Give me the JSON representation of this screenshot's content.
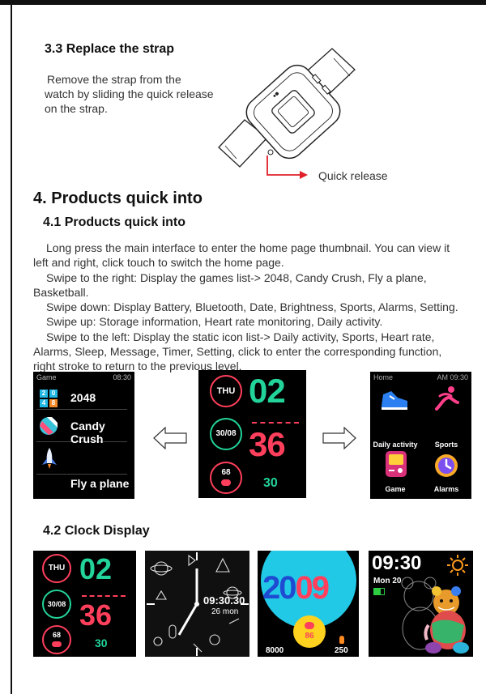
{
  "section_3_3": {
    "heading": "3.3 Replace the strap",
    "body_lines": [
      "Remove the strap from the",
      "watch by sliding the quick release",
      "on the strap."
    ],
    "callout": "Quick release"
  },
  "section_4": {
    "heading": "4. Products quick into",
    "sub_heading": "4.1 Products quick into",
    "para_lines": [
      "Long press the main interface to enter the home page thumbnail. You can view it",
      "left and right, click touch to switch the home page.",
      "Swipe to the right: Display the games list-> 2048, Candy Crush, Fly a plane,",
      "Basketball.",
      "Swipe down: Display Battery, Bluetooth, Date, Brightness, Sports, Alarms, Setting.",
      "Swipe up: Storage information, Heart rate monitoring, Daily activity.",
      "Swipe to the left: Display the static icon list-> Daily activity, Sports, Heart rate,",
      "Alarms, Sleep, Message, Timer, Setting, click to enter the corresponding function,",
      "right stroke to return to the previous level."
    ]
  },
  "game_screen": {
    "title": "Game",
    "time": "08:30",
    "items": [
      "2048",
      "Candy Crush",
      "Fly a plane"
    ],
    "tile_digits": [
      "2",
      "0",
      "4",
      "8"
    ]
  },
  "clock_face": {
    "day": "THU",
    "date": "30/08",
    "heart": "68",
    "hour": "02",
    "minute": "36",
    "seconds": "30"
  },
  "home_screen": {
    "title": "Home",
    "time": "AM 09:30",
    "items": [
      "Daily activity",
      "Sports",
      "Game",
      "Alarms"
    ]
  },
  "section_4_2": {
    "heading": "4.2 Clock Display"
  },
  "face2": {
    "time": "09:30.30",
    "date": "26 mon"
  },
  "face3": {
    "year_a": "20",
    "year_b": "09",
    "heart": "86",
    "steps": "8000",
    "cal": "250"
  },
  "face4": {
    "time": "09:30",
    "date": "Mon 20"
  },
  "colors": {
    "green": "#22d39a",
    "red": "#ff3f5b",
    "blue": "#1e4bd1",
    "yellow": "#ffd21f",
    "cyan": "#22c9e6"
  }
}
